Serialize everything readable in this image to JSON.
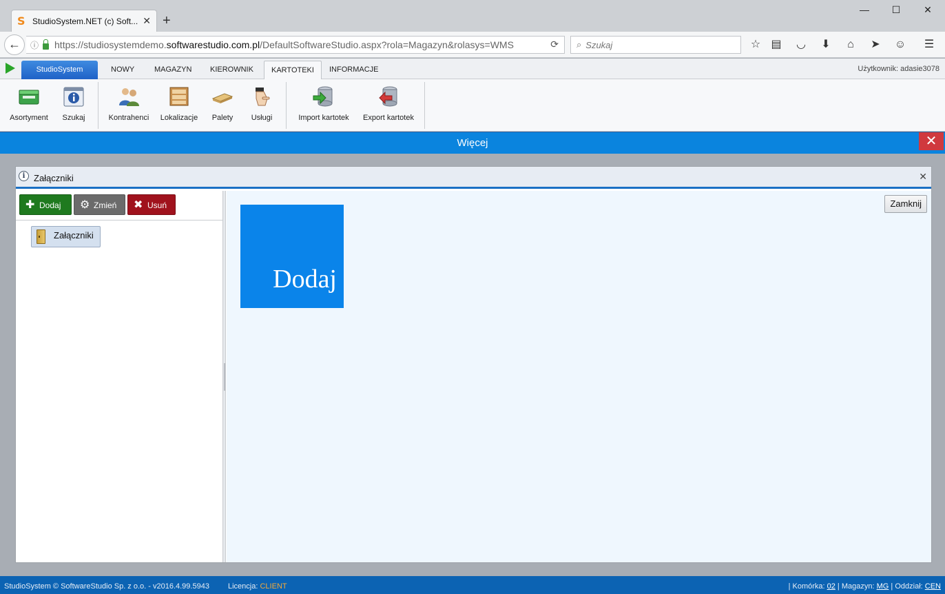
{
  "browser": {
    "tab_title": "StudioSystem.NET (c) Soft...",
    "url_prefix": "https://studiosystemdemo.",
    "url_domain": "softwarestudio.com.pl",
    "url_path": "/DefaultSoftwareStudio.aspx?rola=Magazyn&rolasys=WMS",
    "search_placeholder": "Szukaj"
  },
  "menu": {
    "brand": "StudioSystem",
    "tabs": [
      "NOWY",
      "MAGAZYN",
      "KIEROWNIK",
      "KARTOTEKI",
      "INFORMACJE"
    ],
    "active_tab": "KARTOTEKI",
    "user_label": "Użytkownik: adasie3078"
  },
  "ribbon": {
    "group1": [
      "Asortyment",
      "Szukaj"
    ],
    "group2": [
      "Kontrahenci",
      "Lokalizacje",
      "Palety",
      "Usługi"
    ],
    "group3": [
      "Import kartotek",
      "Export kartotek"
    ]
  },
  "more_bar": {
    "label": "Więcej"
  },
  "dialog": {
    "title": "Załączniki",
    "toolbar": {
      "add": "Dodaj",
      "edit": "Zmień",
      "delete": "Usuń"
    },
    "tree_item": "Załączniki",
    "tile_label": "Dodaj",
    "close_button": "Zamknij"
  },
  "status": {
    "copyright": "StudioSystem © SoftwareStudio Sp. z o.o. - v2016.4.99.5943",
    "license_label": "Licencja:",
    "license_value": "CLIENT",
    "cell_label": "Komórka:",
    "cell_value": "02",
    "warehouse_label": "Magazyn:",
    "warehouse_value": "MG",
    "branch_label": "Oddział:",
    "branch_value": "CEN"
  },
  "colors": {
    "accent_blue": "#0a84de",
    "add_green": "#1f7a1f",
    "delete_red": "#a0121d",
    "close_red": "#d0393e",
    "status_blue": "#0c63b3"
  }
}
